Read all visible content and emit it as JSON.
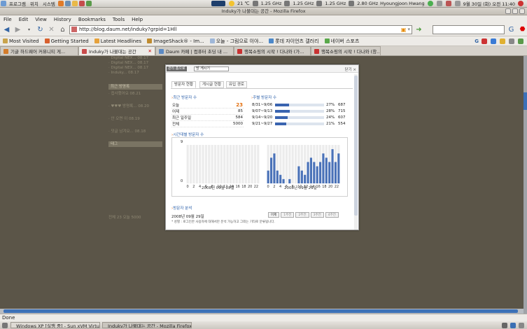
{
  "gnome_panel": {
    "menus": [
      "프로그램",
      "위치",
      "시스템"
    ],
    "temp": "21 ℃",
    "cpu": [
      "1.25 GHz",
      "1.25 GHz",
      "1.25 GHz",
      "2.80 GHz"
    ],
    "user": "Hyoungjoon Hwang",
    "clock": "9월 30일 (화) 오전 11:40"
  },
  "window_title": "Induky가 나불대는 공간 - Mozilla Firefox",
  "menubar": [
    "File",
    "Edit",
    "View",
    "History",
    "Bookmarks",
    "Tools",
    "Help"
  ],
  "url": "http://blog.daum.net/induky?grpid=1Hll",
  "bookmarks": [
    {
      "label": "Most Visited",
      "color": "#c9a44c"
    },
    {
      "label": "Getting Started",
      "color": "#d8602d"
    },
    {
      "label": "Latest Headlines",
      "color": "#e6a23c"
    },
    {
      "label": "ImageShack® - Im...",
      "color": "#bf8b2f"
    },
    {
      "label": "오늘 - 그림으로 이야...",
      "color": "#9fb7d8"
    },
    {
      "label": "롯데 자이언츠 갤러리",
      "color": "#4c88c9"
    },
    {
      "label": "네이버 스포츠",
      "color": "#5aa84a"
    }
  ],
  "tabs": [
    {
      "label": "기글 하드웨어 커뮤니티 게...",
      "active": false,
      "color": "#d27b2a"
    },
    {
      "label": "Induky가 나불대는 공간",
      "active": true,
      "color": "#c84b4b"
    },
    {
      "label": "Daum 카페 | 컴퓨터 초딩 내 ...",
      "active": false,
      "color": "#5c8ac4"
    },
    {
      "label": "행복쇼핑의 시작 ! 다나와 (가...",
      "active": false,
      "color": "#c83232"
    },
    {
      "label": "행복쇼핑의 시작 ! 다나와 (창...",
      "active": false,
      "color": "#c83232"
    }
  ],
  "sidebar": {
    "items_top": [
      "· Digital NEX... 08.17",
      "· Digital NEX... 08.17",
      "· Digital NEX... 08.17",
      "· Induky... 08.17"
    ],
    "header": "최근 방명록",
    "guest": [
      "· 접사했어요 08.21",
      "· ♥♥♥ 방명록... 08.20",
      "· 안 오면 이 08.19",
      "· 덧글 남겨요... 08.18"
    ],
    "header2": "태그",
    "footer": "전체 23  오늘 5000"
  },
  "popup": {
    "tag": "관리 홈으로",
    "select": "방 게시기",
    "close": "닫기 ×",
    "tabs": [
      "방문자 현황",
      "게시글 현황",
      "유입 경로"
    ],
    "recent_title": "최근 방문자 수",
    "recent": [
      {
        "label": "오늘",
        "value": "23"
      },
      {
        "label": "어제",
        "value": "85"
      },
      {
        "label": "최근 일주일",
        "value": "584"
      },
      {
        "label": "전체",
        "value": "5000"
      }
    ],
    "weekly_title": "주별 방문자 수",
    "weekly": [
      {
        "range": "8/31~9/06",
        "pct": "27%",
        "value": "687",
        "ratio": 0.27
      },
      {
        "range": "9/07~9/13",
        "pct": "28%",
        "value": "715",
        "ratio": 0.28
      },
      {
        "range": "9/14~9/20",
        "pct": "24%",
        "value": "607",
        "ratio": 0.24
      },
      {
        "range": "9/21~9/27",
        "pct": "21%",
        "value": "554",
        "ratio": 0.21
      }
    ],
    "hourly_title": "시간대별 방문자 수",
    "analysis_title": "방문자 분석",
    "analysis_date": "2008년 09월 29일",
    "period_buttons": [
      "어제",
      "1주전",
      "2주전",
      "3주전",
      "4주전"
    ],
    "analysis_note": "* 성별 : 로그인한 사용자에 대해서만 분석 가능하고 그외는 기타로 분류됩니다."
  },
  "chart_data": {
    "type": "bar",
    "title": "시간대별 방문자 수",
    "ylim": [
      0,
      9
    ],
    "yticks": [
      "0",
      "9"
    ],
    "xticks": [
      "0",
      "2",
      "4",
      "6",
      "8",
      "10",
      "12",
      "14",
      "16",
      "18",
      "20",
      "22"
    ],
    "series": [
      {
        "name": "2008년 09월 28일",
        "values": [
          0,
          0,
          0,
          0,
          0,
          0,
          0,
          0,
          0,
          0,
          0,
          0,
          0,
          0,
          0,
          0,
          0,
          0,
          0,
          0,
          0,
          0,
          0,
          0
        ]
      },
      {
        "name": "2008년 09월 29일",
        "values": [
          3,
          6,
          7,
          3,
          2,
          1,
          0,
          1,
          0,
          0,
          4,
          3,
          2,
          5,
          6,
          5,
          4,
          5,
          7,
          6,
          5,
          8,
          5,
          7
        ]
      }
    ]
  },
  "status": "Done",
  "taskbar": [
    "Windows XP [실행 중] - Sun xVM Virtual...",
    "Induky가 나불대는 공간 - Mozilla Firefox"
  ]
}
